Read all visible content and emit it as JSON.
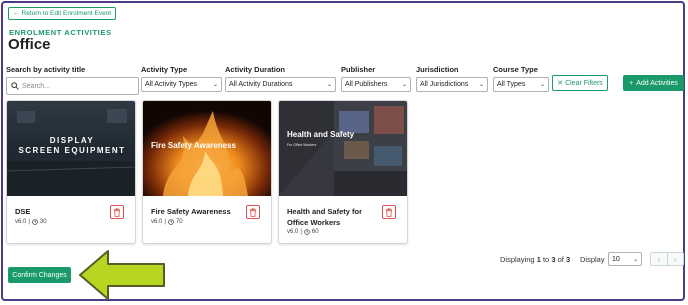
{
  "header": {
    "back_label": "Return to Edit Enrolment Event",
    "section_label": "ENROLMENT ACTIVITIES",
    "title": "Office"
  },
  "filters": {
    "search": {
      "label": "Search by activity title",
      "placeholder": "Search..."
    },
    "activity_type": {
      "label": "Activity Type",
      "value": "All Activity Types"
    },
    "activity_duration": {
      "label": "Activity Duration",
      "value": "All Activity Durations"
    },
    "publisher": {
      "label": "Publisher",
      "value": "All Publishers"
    },
    "jurisdiction": {
      "label": "Jurisdiction",
      "value": "All Jurisdictions"
    },
    "course_type": {
      "label": "Course Type",
      "value": "All Types"
    },
    "clear_label": "Clear Filters",
    "add_label": "Add Activities"
  },
  "cards": [
    {
      "thumb_line1": "DISPLAY",
      "thumb_line2": "SCREEN EQUIPMENT",
      "title": "DSE",
      "version": "v6.0",
      "duration": "30"
    },
    {
      "thumb_title": "Fire Safety Awareness",
      "title": "Fire Safety Awareness",
      "version": "v6.0",
      "duration": "70"
    },
    {
      "thumb_title": "Health and Safety",
      "thumb_sub": "For Office Workers",
      "title": "Health and Safety for Office Workers",
      "version": "v6.0",
      "duration": "60"
    }
  ],
  "pagination": {
    "prefix": "Displaying",
    "from": "1",
    "to_word": "to",
    "to": "3",
    "of_word": "of",
    "total": "3",
    "display_label": "Display",
    "per_page": "10"
  },
  "footer": {
    "confirm_label": "Confirm Changes"
  },
  "colors": {
    "brand_green": "#1a9a6a",
    "frame": "#4b3a86",
    "arrow": "#b6d61f",
    "delete_red": "#d9534f"
  }
}
